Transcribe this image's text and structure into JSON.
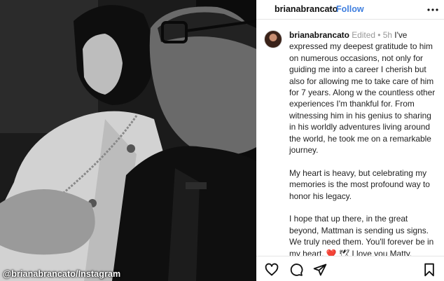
{
  "photo": {
    "credit": "@brianabrancato/Instagram"
  },
  "header": {
    "username": "brianabrancato",
    "separator": "•",
    "follow_label": "Follow",
    "more_icon": "more-horizontal-icon"
  },
  "post": {
    "author": "brianabrancato",
    "edited": "Edited",
    "separator": "•",
    "time": "5h",
    "paragraph1": "I've expressed my deepest gratitude to him on numerous occasions, not only for guiding me into a career I cherish but also for allowing me to take care of him for 7 years. Along w the countless other experiences I'm thankful for. From witnessing him in his genius to sharing in his worldly adventures living around the world, he took me on a remarkable journey.",
    "paragraph2": "My heart is heavy, but celebrating my memories is the most profound way to honor his legacy.",
    "paragraph3_a": "I hope that up there, in the great beyond, Mattman is sending us signs. We truly need them. You'll forever be in my heart.",
    "paragraph3_emoji": "❤️",
    "paragraph3_emoji2": "🕊",
    "paragraph3_b": "I love you Matty."
  },
  "actions": {
    "like_icon": "heart-icon",
    "comment_icon": "comment-icon",
    "share_icon": "share-icon",
    "save_icon": "bookmark-icon"
  },
  "colors": {
    "follow": "#3f7fdf",
    "heart_emoji": "#d1173b",
    "meta": "#999999"
  }
}
